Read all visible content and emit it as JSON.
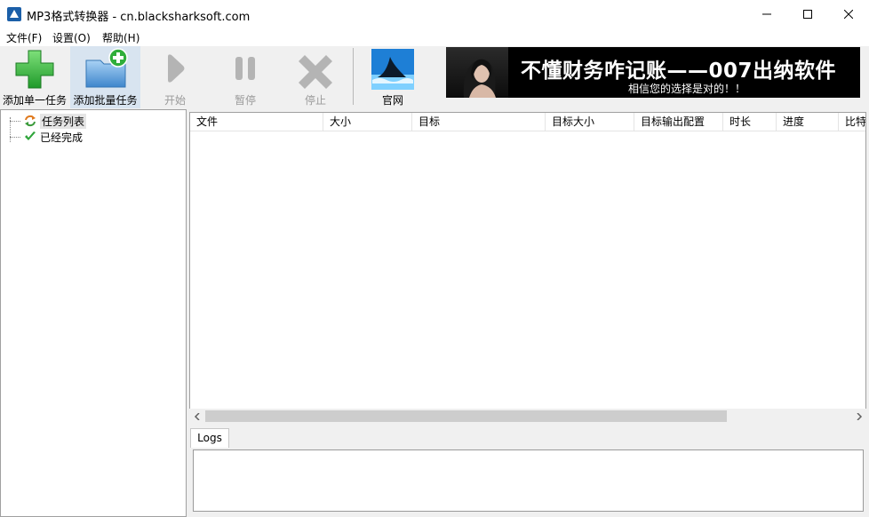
{
  "window": {
    "title": "MP3格式转换器 - cn.blacksharksoft.com",
    "controls": {
      "minimize": "—",
      "maximize": "☐",
      "close": "✕"
    }
  },
  "menu": [
    {
      "label": "文件(F)"
    },
    {
      "label": "设置(O)"
    },
    {
      "label": "帮助(H)"
    }
  ],
  "toolbar": {
    "add_single": "添加单一任务",
    "add_batch": "添加批量任务",
    "start": "开始",
    "pause": "暂停",
    "stop": "停止",
    "website": "官网"
  },
  "banner": {
    "title": "不懂财务咋记账——007出纳软件",
    "subtitle": "相信您的选择是对的！！"
  },
  "tree": [
    {
      "label": "任务列表",
      "icon": "refresh-arrows-icon"
    },
    {
      "label": "已经完成",
      "icon": "checkmark-icon"
    }
  ],
  "table": {
    "columns": [
      "文件",
      "大小",
      "目标",
      "目标大小",
      "目标输出配置",
      "时长",
      "进度",
      "比特"
    ],
    "rows": []
  },
  "logs": {
    "tab_label": "Logs",
    "content": ""
  },
  "colors": {
    "accent_green": "#3cb043",
    "folder_blue": "#4a90d9",
    "disabled_gray": "#9a9a9a",
    "banner_bg": "#000000"
  }
}
